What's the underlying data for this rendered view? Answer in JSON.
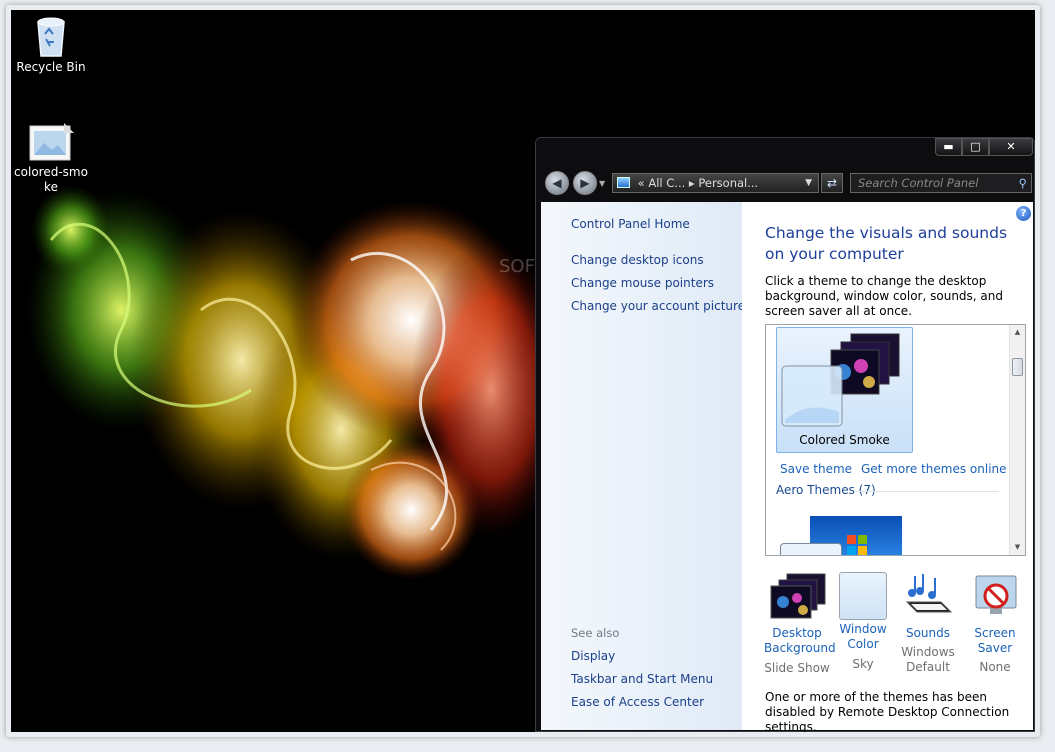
{
  "desktop": {
    "icons": [
      {
        "label": "Recycle Bin",
        "icon": "recycle-bin-icon"
      },
      {
        "label": "colored-smoke",
        "icon": "image-file-icon"
      }
    ],
    "watermark": "SOFTPEDIA"
  },
  "window": {
    "caption_buttons": [
      "minimize",
      "maximize",
      "close"
    ],
    "nav": {
      "back": "back-arrow-icon",
      "forward": "forward-arrow-icon",
      "address": "«  All C...  ▸  Personal...",
      "search_placeholder": "Search Control Panel"
    },
    "sidebar": {
      "home": "Control Panel Home",
      "links": [
        "Change desktop icons",
        "Change mouse pointers",
        "Change your account picture"
      ],
      "see_also_title": "See also",
      "see_also": [
        "Display",
        "Taskbar and Start Menu",
        "Ease of Access Center"
      ]
    },
    "main": {
      "heading": "Change the visuals and sounds on your computer",
      "intro": "Click a theme to change the desktop background, window color, sounds, and screen saver all at once.",
      "selected_theme": "Colored Smoke",
      "save_theme": "Save theme",
      "get_more": "Get more themes online",
      "aero_group": "Aero Themes (7)",
      "bottom": [
        {
          "label1": "Desktop",
          "label2": "Background",
          "sub1": "Slide Show",
          "sub2": ""
        },
        {
          "label1": "Window",
          "label2": "Color",
          "sub1": "Sky",
          "sub2": ""
        },
        {
          "label1": "Sounds",
          "label2": "",
          "sub1": "Windows",
          "sub2": "Default"
        },
        {
          "label1": "Screen Saver",
          "label2": "",
          "sub1": "None",
          "sub2": ""
        }
      ],
      "note": "One or more of the themes has been disabled by Remote Desktop Connection settings."
    }
  }
}
